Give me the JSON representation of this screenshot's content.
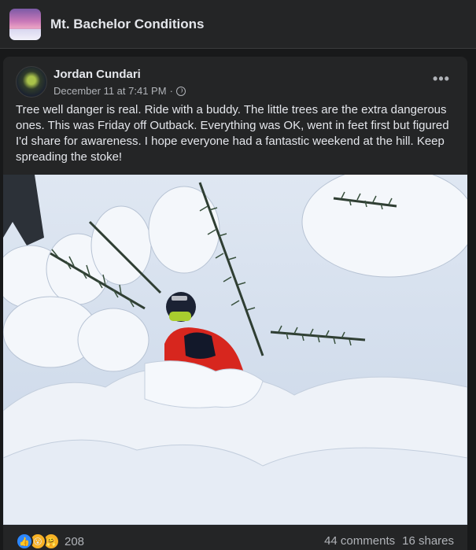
{
  "group": {
    "name": "Mt. Bachelor Conditions",
    "thumb_icon": "group-cover-thumbnail"
  },
  "post": {
    "author": "Jordan Cundari",
    "timestamp": "December 11 at 7:41 PM",
    "separator": "·",
    "privacy_icon": "globe-icon",
    "more_icon": "more-options-icon",
    "more_label": "•••",
    "text": "Tree well danger is real. Ride with a buddy. The little trees are the extra dangerous ones. This was Friday off Outback. Everything was OK, went in feet first but figured I'd share for awareness. I hope everyone had a fantastic weekend at the hill. Keep spreading the stoke!",
    "photo_icon": "post-photo",
    "reactions": {
      "icons": [
        "like-icon",
        "wow-icon",
        "care-icon"
      ],
      "glyphs": [
        "👍",
        "😮",
        "🤗"
      ],
      "count": "208"
    },
    "comments": "44 comments",
    "shares": "16 shares"
  },
  "colors": {
    "background": "#18191a",
    "card": "#242526",
    "text_primary": "#e4e6eb",
    "text_secondary": "#b0b3b8",
    "like_blue": "#2d88ff",
    "jacket_red": "#d7261e"
  }
}
